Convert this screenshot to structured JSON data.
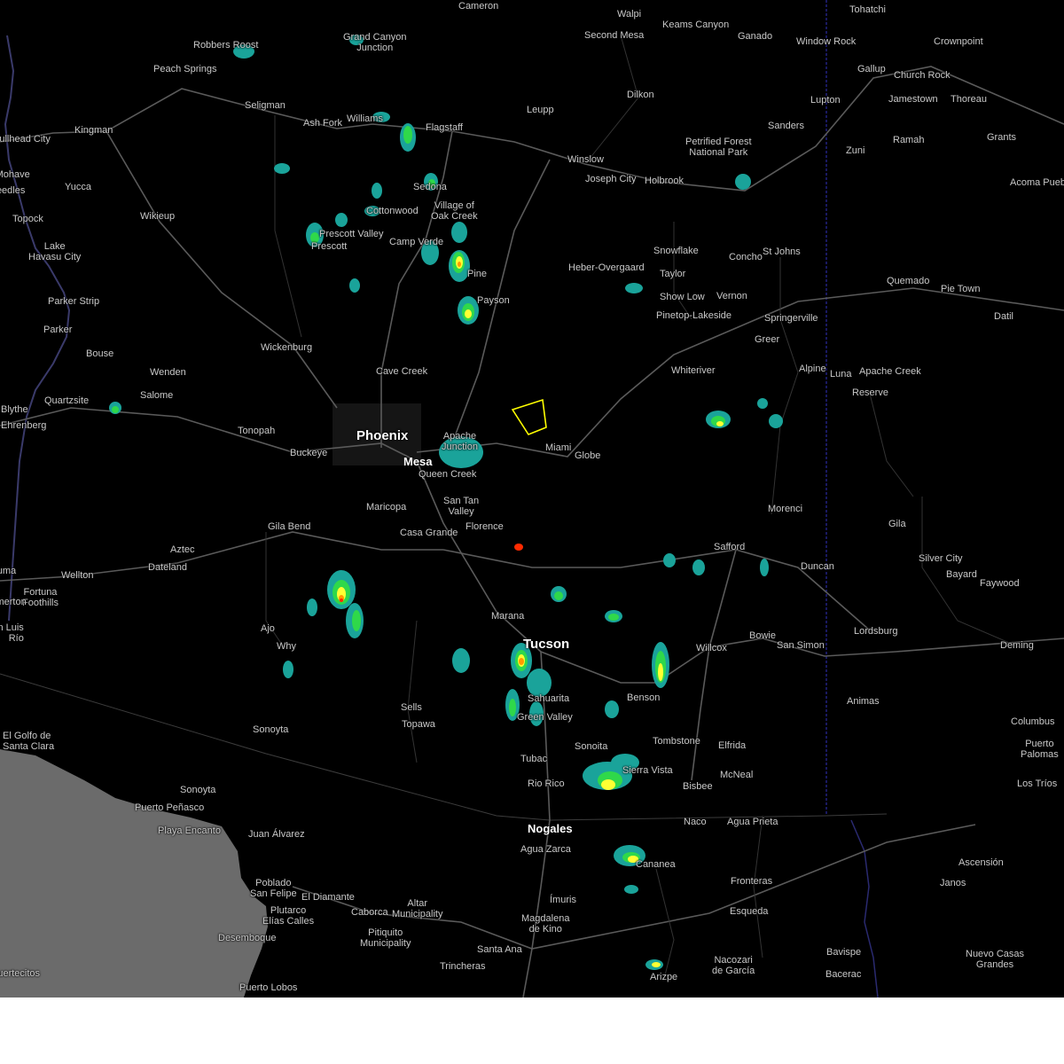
{
  "map": {
    "colors": {
      "background": "#000000",
      "ocean": "#6b6b6b",
      "roads": "#5a5a5a",
      "state_line": "#2a2aa0",
      "warning_polygon": "#ffff00",
      "radar_light": "#1aa39a",
      "radar_green": "#2fd84a",
      "radar_yellow": "#ffff33",
      "radar_orange": "#ff9900",
      "radar_red": "#ff2a00"
    },
    "places": {
      "cameron": "Cameron",
      "walpi": "Walpi",
      "keams_canyon": "Keams Canyon",
      "tohatchi": "Tohatchi",
      "robbers_roost": "Robbers Roost",
      "grand_canyon_junction": "Grand Canyon\nJunction",
      "second_mesa": "Second Mesa",
      "ganado": "Ganado",
      "window_rock": "Window Rock",
      "crownpoint": "Crownpoint",
      "peach_springs": "Peach Springs",
      "gallup": "Gallup",
      "church_rock": "Church Rock",
      "seligman": "Seligman",
      "dilkon": "Dilkon",
      "jamestown": "Jamestown",
      "thoreau": "Thoreau",
      "lupton": "Lupton",
      "leupp": "Leupp",
      "ash_fork": "Ash Fork",
      "williams": "Williams",
      "flagstaff": "Flagstaff",
      "kingman": "Kingman",
      "sanders": "Sanders",
      "bullhead_city": "Bullhead City",
      "ramah": "Ramah",
      "grants": "Grants",
      "petrified_forest": "Petrified Forest\nNational Park",
      "zuni": "Zuni",
      "fort_mohave": "Fort Mohave",
      "winslow": "Winslow",
      "joseph_city": "Joseph City",
      "holbrook": "Holbrook",
      "needles": "Needles",
      "yucca": "Yucca",
      "sedona": "Sedona",
      "acoma_pueblo": "Acoma Pueblo",
      "wikieup": "Wikieup",
      "cottonwood": "Cottonwood",
      "village_of_oak_creek": "Village of\nOak Creek",
      "topock": "Topock",
      "prescott_valley": "Prescott Valley",
      "prescott": "Prescott",
      "camp_verde": "Camp Verde",
      "snowflake": "Snowflake",
      "concho": "Concho",
      "st_johns": "St Johns",
      "lake_havasu_city": "Lake\nHavasu City",
      "heber_overgaard": "Heber-Overgaard",
      "taylor": "Taylor",
      "pine": "Pine",
      "quemado": "Quemado",
      "pie_town": "Pie Town",
      "show_low": "Show Low",
      "vernon": "Vernon",
      "parker_strip": "Parker Strip",
      "payson": "Payson",
      "pinetop_lakeside": "Pinetop-Lakeside",
      "springerville": "Springerville",
      "datil": "Datil",
      "parker": "Parker",
      "greer": "Greer",
      "wickenburg": "Wickenburg",
      "bouse": "Bouse",
      "wenden": "Wenden",
      "cave_creek": "Cave Creek",
      "whiteriver": "Whiteriver",
      "alpine": "Alpine",
      "luna": "Luna",
      "apache_creek": "Apache Creek",
      "salome": "Salome",
      "reserve": "Reserve",
      "blythe": "Blythe",
      "quartzsite": "Quartzsite",
      "ehrenberg": "Ehrenberg",
      "tonopah": "Tonopah",
      "phoenix": "Phoenix",
      "apache_junction": "Apache\nJunction",
      "buckeye": "Buckeye",
      "mesa": "Mesa",
      "miami": "Miami",
      "globe": "Globe",
      "queen_creek": "Queen Creek",
      "san_tan_valley": "San Tan\nValley",
      "maricopa": "Maricopa",
      "morenci": "Morenci",
      "gila": "Gila",
      "gila_bend": "Gila Bend",
      "casa_grande": "Casa Grande",
      "florence": "Florence",
      "aztec": "Aztec",
      "safford": "Safford",
      "silver_city": "Silver City",
      "dateland": "Dateland",
      "duncan": "Duncan",
      "bayard": "Bayard",
      "yuma": "Yuma",
      "wellton": "Wellton",
      "faywood": "Faywood",
      "fortuna_foothills": "Fortuna\nFoothills",
      "somerton": "Somerton",
      "marana": "Marana",
      "ajo": "Ajo",
      "lordsburg": "Lordsburg",
      "bowie": "Bowie",
      "tucson": "Tucson",
      "why": "Why",
      "san_simon": "San Simon",
      "willcox": "Willcox",
      "deming": "Deming",
      "san_luis_rio": "San Luis\nRío",
      "benson": "Benson",
      "animas": "Animas",
      "sells": "Sells",
      "sahuarita": "Sahuarita",
      "green_valley": "Green Valley",
      "topawa": "Topawa",
      "columbus": "Columbus",
      "sonoyta": "Sonoyta",
      "el_golfo": "El Golfo de\nSanta Clara",
      "tombstone": "Tombstone",
      "sonoita": "Sonoita",
      "elfrida": "Elfrida",
      "puerto_palomas": "Puerto\nPalomas",
      "tubac": "Tubac",
      "sierra_vista": "Sierra Vista",
      "mcneal": "McNeal",
      "los_trios": "Los Tríos",
      "rio_rico": "Rio Rico",
      "bisbee": "Bisbee",
      "sonoyta_mx": "Sonoyta",
      "puerto_penasco": "Puerto Peñasco",
      "naco": "Naco",
      "agua_prieta": "Agua Prieta",
      "playa_encanto": "Playa Encanto",
      "nogales": "Nogales",
      "juan_alvarez": "Juan Álvarez",
      "agua_zarca": "Agua Zarca",
      "cananea": "Cananea",
      "ascension": "Ascensión",
      "fronteras": "Fronteras",
      "janos": "Janos",
      "poblado_san_felipe": "Poblado\nSan Felipe",
      "el_diamante": "El Diamante",
      "imuris": "Ímuris",
      "altar": "Altar\nMunicipality",
      "plutarco": "Plutarco\nElías Calles",
      "esqueda": "Esqueda",
      "caborca": "Caborca",
      "magdalena": "Magdalena\nde Kino",
      "pitiquito": "Pitiquito\nMunicipality",
      "desemboque": "Desemboque",
      "santa_ana": "Santa Ana",
      "bavispe": "Bavispe",
      "nuevo_casas_grandes": "Nuevo Casas\nGrandes",
      "trincheras": "Trincheras",
      "nacozari": "Nacozari\nde García",
      "bacerac": "Bacerac",
      "arizpe": "Arizpe",
      "puertecitos": "Puertecitos",
      "puerto_lobos": "Puerto Lobos"
    }
  }
}
